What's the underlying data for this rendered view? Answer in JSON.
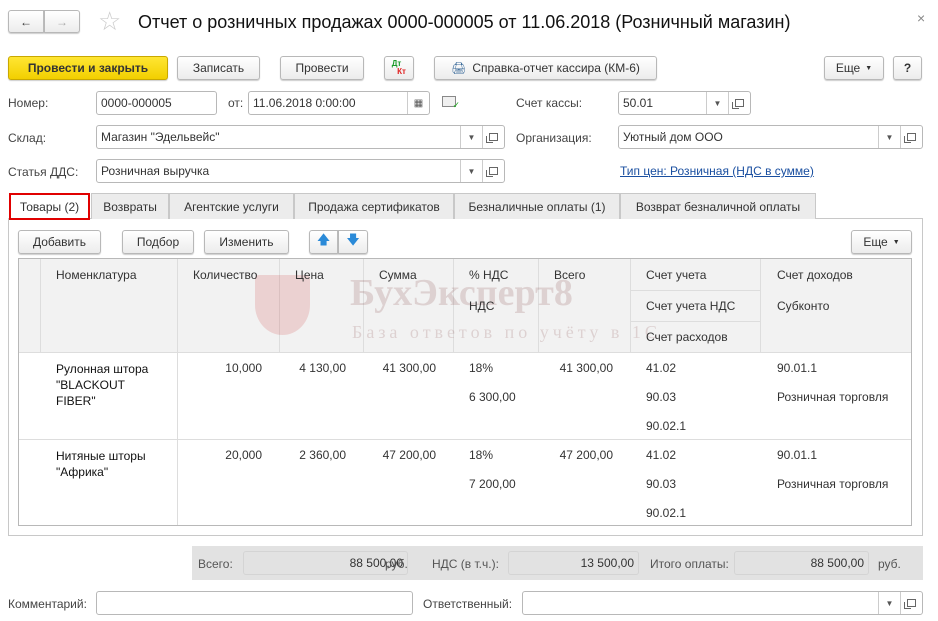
{
  "window": {
    "title": "Отчет о розничных продажах 0000-000005 от 11.06.2018 (Розничный магазин)"
  },
  "toolbar": {
    "post_close": "Провести и закрыть",
    "save": "Записать",
    "post": "Провести",
    "dtkt_dt": "Дт",
    "dtkt_kt": "Кт",
    "report": "Справка-отчет кассира (КМ-6)",
    "more": "Еще",
    "help": "?"
  },
  "header": {
    "number_label": "Номер:",
    "number": "0000-000005",
    "date_label": "от:",
    "date": "11.06.2018  0:00:00",
    "cash_account_label": "Счет кассы:",
    "cash_account": "50.01",
    "warehouse_label": "Склад:",
    "warehouse": "Магазин \"Эдельвейс\"",
    "org_label": "Организация:",
    "org": "Уютный дом ООО",
    "dds_label": "Статья ДДС:",
    "dds": "Розничная выручка",
    "price_type_link": "Тип цен: Розничная (НДС в сумме)"
  },
  "tabs": [
    {
      "label": "Товары (2)",
      "active": true
    },
    {
      "label": "Возвраты"
    },
    {
      "label": "Агентские услуги"
    },
    {
      "label": "Продажа сертификатов"
    },
    {
      "label": "Безналичные оплаты (1)"
    },
    {
      "label": "Возврат безналичной оплаты"
    }
  ],
  "table_toolbar": {
    "add": "Добавить",
    "pick": "Подбор",
    "edit": "Изменить",
    "more": "Еще"
  },
  "table": {
    "headers": {
      "item": "Номенклатура",
      "qty": "Количество",
      "price": "Цена",
      "sum": "Сумма",
      "vat_rate": "% НДС",
      "vat": "НДС",
      "total": "Всего",
      "account": "Счет учета",
      "vat_account": "Счет учета НДС",
      "expense_account": "Счет расходов",
      "income_account": "Счет доходов",
      "subconto": "Субконто"
    },
    "rows": [
      {
        "item": "Рулонная штора \"BLACKOUT FIBER\"",
        "qty": "10,000",
        "price": "4 130,00",
        "sum": "41 300,00",
        "vat_rate": "18%",
        "vat": "6 300,00",
        "total": "41 300,00",
        "account": "41.02",
        "vat_account": "90.03",
        "expense_account": "90.02.1",
        "income_account": "90.01.1",
        "subconto": "Розничная торговля"
      },
      {
        "item": "Нитяные шторы \"Африка\"",
        "qty": "20,000",
        "price": "2 360,00",
        "sum": "47 200,00",
        "vat_rate": "18%",
        "vat": "7 200,00",
        "total": "47 200,00",
        "account": "41.02",
        "vat_account": "90.03",
        "expense_account": "90.02.1",
        "income_account": "90.01.1",
        "subconto": "Розничная торговля"
      }
    ]
  },
  "totals": {
    "total_label": "Всего:",
    "total": "88 500,00",
    "cur1": "руб.",
    "vat_label": "НДС (в т.ч.):",
    "vat": "13 500,00",
    "paid_label": "Итого оплаты:",
    "paid": "88 500,00",
    "cur2": "руб."
  },
  "footer": {
    "comment_label": "Комментарий:",
    "comment": "",
    "responsible_label": "Ответственный:",
    "responsible": ""
  },
  "watermark": {
    "brand": "БухЭксперт8",
    "tagline": "База ответов по учёту в 1С"
  },
  "colors": {
    "primary_button": "#f7d600",
    "link": "#1a4fa0",
    "active_tab_outline": "#e00000"
  }
}
